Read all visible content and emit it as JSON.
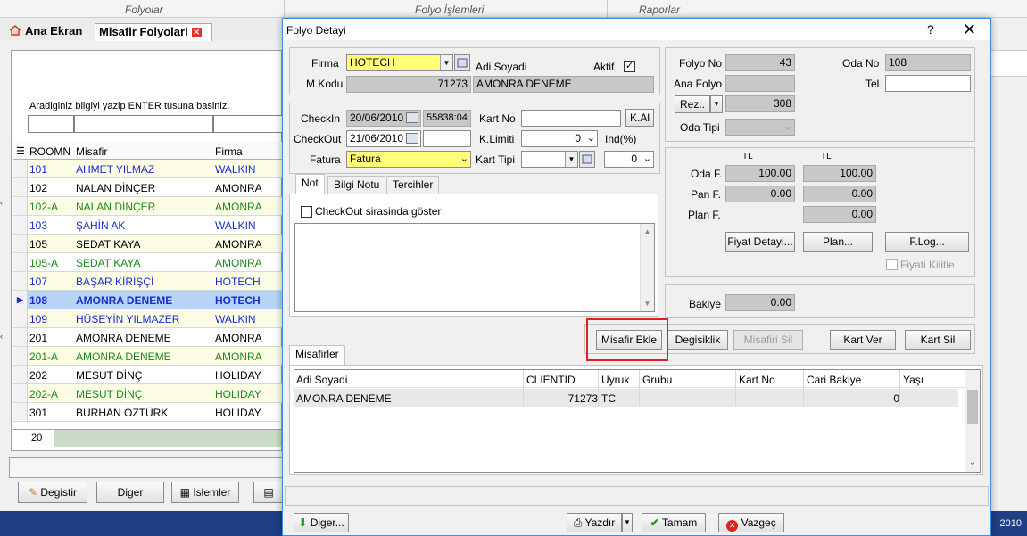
{
  "menu": {
    "sections": [
      "Folyolar",
      "Folyo İşlemleri",
      "Raporlar"
    ]
  },
  "tabs": {
    "home": "Ana Ekran",
    "folios": "Misafir Folyolari"
  },
  "search": {
    "hint": "Aradiginiz bilgiyi yazip ENTER tusuna basiniz."
  },
  "grid": {
    "headers": {
      "room": "ROOMN",
      "guest": "Misafir",
      "firm": "Firma"
    },
    "rows": [
      {
        "room": "101",
        "guest": "AHMET YILMAZ",
        "firm": "WALKIN",
        "style": "blue yellow"
      },
      {
        "room": "102",
        "guest": "NALAN DİNÇER",
        "firm": "AMONRA",
        "style": "black"
      },
      {
        "room": "102-A",
        "guest": "NALAN DİNÇER",
        "firm": "AMONRA",
        "style": "green yellow"
      },
      {
        "room": "103",
        "guest": "ŞAHİN AK",
        "firm": "WALKIN",
        "style": "blue"
      },
      {
        "room": "105",
        "guest": "SEDAT KAYA",
        "firm": "AMONRA",
        "style": "black yellow"
      },
      {
        "room": "105-A",
        "guest": "SEDAT KAYA",
        "firm": "AMONRA",
        "style": "green"
      },
      {
        "room": "107",
        "guest": "BAŞAR KİRİŞÇİ",
        "firm": "HOTECH",
        "style": "blue yellow"
      },
      {
        "room": "108",
        "guest": "AMONRA DENEME",
        "firm": "HOTECH",
        "style": "selected"
      },
      {
        "room": "109",
        "guest": "HÜSEYİN YILMAZER",
        "firm": "WALKIN",
        "style": "blue yellow"
      },
      {
        "room": "201",
        "guest": "AMONRA DENEME",
        "firm": "AMONRA",
        "style": "black"
      },
      {
        "room": "201-A",
        "guest": "AMONRA DENEME",
        "firm": "AMONRA",
        "style": "green yellow"
      },
      {
        "room": "202",
        "guest": "MESUT DİNÇ",
        "firm": "HOLIDAY",
        "style": "black"
      },
      {
        "room": "202-A",
        "guest": "MESUT DİNÇ",
        "firm": "HOLIDAY",
        "style": "green yellow"
      },
      {
        "room": "301",
        "guest": "BURHAN ÖZTÜRK",
        "firm": "HOLIDAY",
        "style": "black"
      }
    ],
    "count": "20"
  },
  "bottom_buttons": {
    "edit": "Degistir",
    "other": "Diger",
    "ops": "Islemler"
  },
  "taskbar": {
    "year": "2010"
  },
  "dialog": {
    "title": "Folyo Detayi",
    "help": "?",
    "close": "✕",
    "firma_label": "Firma",
    "firma_value": "HOTECH",
    "adi_soyadi_label": "Adi Soyadi",
    "aktif_label": "Aktif",
    "aktif_checked": "✓",
    "mkodu_label": "M.Kodu",
    "mkodu_value": "71273",
    "name_value": "AMONRA DENEME",
    "checkin_label": "CheckIn",
    "checkin_date": "20/06/2010",
    "checkin_extra": "55838:04",
    "checkout_label": "CheckOut",
    "checkout_date": "21/06/2010",
    "fatura_label": "Fatura",
    "fatura_value": "Fatura",
    "kartno_label": "Kart No",
    "kartno_value": "",
    "kal_button": "K.Al",
    "klimit_label": "K.Limiti",
    "klimit_value": "0",
    "ind_label": "Ind(%)",
    "karttipi_label": "Kart Tipi",
    "karttipi_value": "0",
    "note_tabs": [
      "Not",
      "Bilgi Notu",
      "Tercihler"
    ],
    "checkout_show_label": "CheckOut sirasinda göster",
    "folyono_label": "Folyo No",
    "folyono_value": "43",
    "odano_label": "Oda No",
    "odano_value": "108",
    "anafolyo_label": "Ana Folyo",
    "tel_label": "Tel",
    "rez_button": "Rez..",
    "rez_value": "308",
    "odatipi_label": "Oda Tipi",
    "currency_1": "TL",
    "currency_2": "TL",
    "odaf_label": "Oda F.",
    "odaf_1": "100.00",
    "odaf_2": "100.00",
    "panf_label": "Pan F.",
    "panf_1": "0.00",
    "panf_2": "0.00",
    "planf_label": "Plan F.",
    "planf_2": "0.00",
    "fiyat_detay_button": "Fiyat Detayi...",
    "plan_button": "Plan...",
    "flog_button": "F.Log...",
    "fiyati_kilitle_label": "Fiyati Kilitle",
    "bakiye_label": "Bakiye",
    "bakiye_value": "0.00",
    "misafir_ekle_button": "Misafir Ekle",
    "degisiklik_button": "Degisiklik",
    "misafiri_sil_button": "Misafiri Sil",
    "kart_ver_button": "Kart Ver",
    "kart_sil_button": "Kart Sil",
    "misafirler_tab": "Misafirler",
    "guest_headers": [
      "Adi Soyadi",
      "CLIENTID",
      "Uyruk",
      "Grubu",
      "Kart No",
      "Cari Bakiye",
      "Yaşı"
    ],
    "guest_row": {
      "name": "AMONRA DENEME",
      "clientid": "71273",
      "uyruk": "TC",
      "cari": "0"
    },
    "diger_button": "Diger...",
    "yazdir_button": "Yazdır",
    "tamam_button": "Tamam",
    "vazgec_button": "Vazgeç"
  },
  "colors": {
    "highlight": "#e02020",
    "title_accent": "#3a8ee6",
    "selected_row": "#b7d3f5"
  }
}
